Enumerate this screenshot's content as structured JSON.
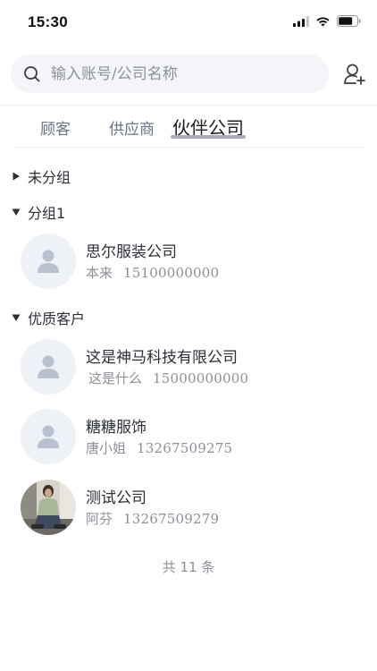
{
  "status_bar": {
    "time": "15:30"
  },
  "search": {
    "placeholder": "输入账号/公司名称",
    "value": ""
  },
  "tabs": [
    {
      "label": "顾客",
      "active": false
    },
    {
      "label": "供应商",
      "active": false
    },
    {
      "label": "伙伴公司",
      "active": true
    }
  ],
  "groups": [
    {
      "name": "未分组",
      "expanded": false,
      "contacts": []
    },
    {
      "name": "分组1",
      "expanded": true,
      "contacts": [
        {
          "name": "思尔服装公司",
          "person": "本来",
          "phone": "15100000000",
          "avatar": "default-avatar-icon"
        }
      ]
    },
    {
      "name": "优质客户",
      "expanded": true,
      "contacts": [
        {
          "name": "这是神马科技有限公司",
          "person": "这是什么",
          "phone": "15000000000",
          "avatar": "default-avatar-icon"
        },
        {
          "name": "糖糖服饰",
          "person": "唐小姐",
          "phone": "13267509275",
          "avatar": "default-avatar-icon"
        },
        {
          "name": "测试公司",
          "person": "阿芬",
          "phone": "13267509279",
          "avatar": "photo-avatar"
        }
      ]
    }
  ],
  "footer": {
    "total_text": "共 11 条"
  },
  "colors": {
    "accent_indicator": "#a9aeb7",
    "text_primary": "#2b2f36",
    "text_secondary": "#8c9098",
    "avatar_bg": "#eef1f6",
    "avatar_fg": "#b9c0cf"
  }
}
